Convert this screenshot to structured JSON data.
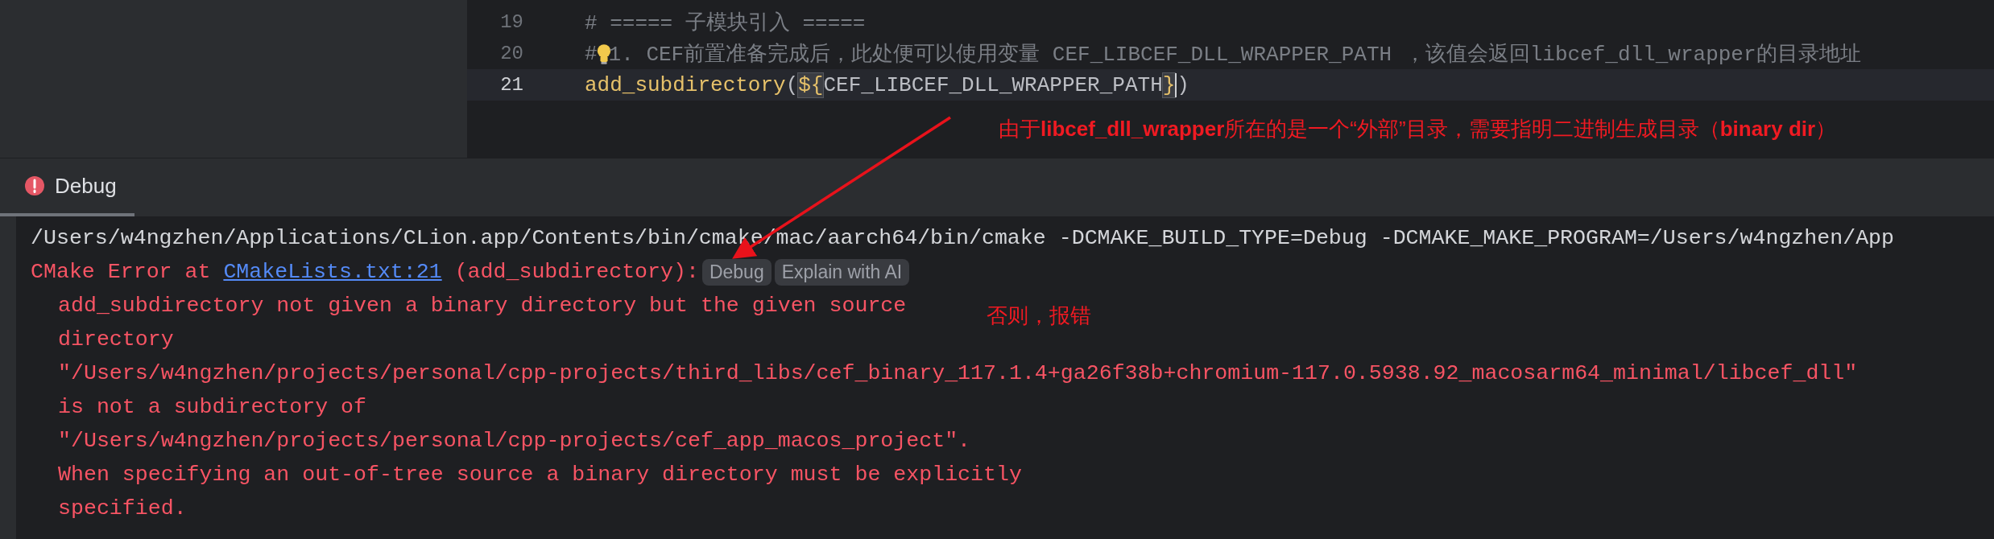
{
  "editor": {
    "lines": [
      {
        "number": "19",
        "current": false,
        "tokens": [
          {
            "kind": "comment",
            "text": "# ===== 子模块引入 ====="
          }
        ]
      },
      {
        "number": "20",
        "current": false,
        "tokens": [
          {
            "kind": "comment",
            "text": "#"
          },
          {
            "kind": "bulb"
          },
          {
            "kind": "comment",
            "text": "1. CEF前置准备完成后，此处便可以使用变量 CEF_LIBCEF_DLL_WRAPPER_PATH ，该值会返回libcef_dll_wrapper的目录地址"
          }
        ]
      },
      {
        "number": "21",
        "current": true,
        "tokens": [
          {
            "kind": "function",
            "text": "add_subdirectory"
          },
          {
            "kind": "plain",
            "text": "("
          },
          {
            "kind": "brace",
            "text": "${"
          },
          {
            "kind": "plain",
            "text": "CEF_LIBCEF_DLL_WRAPPER_PATH"
          },
          {
            "kind": "brace",
            "text": "}"
          },
          {
            "kind": "caret"
          },
          {
            "kind": "plain",
            "text": ")"
          }
        ]
      }
    ]
  },
  "debug_panel": {
    "tab": {
      "label": "Debug",
      "selected": true
    },
    "console": [
      {
        "kind": "command",
        "indent": false,
        "parts": [
          {
            "kind": "text",
            "text": "/Users/w4ngzhen/Applications/CLion.app/Contents/bin/cmake/mac/aarch64/bin/cmake -DCMAKE_BUILD_TYPE=Debug -DCMAKE_MAKE_PROGRAM=/Users/w4ngzhen/App"
          }
        ]
      },
      {
        "kind": "error",
        "indent": false,
        "parts": [
          {
            "kind": "text",
            "text": "CMake Error at "
          },
          {
            "kind": "link",
            "text": "CMakeLists.txt:21"
          },
          {
            "kind": "text",
            "text": " (add_subdirectory):"
          },
          {
            "kind": "action",
            "text": "Debug"
          },
          {
            "kind": "action",
            "text": "Explain with AI"
          }
        ]
      },
      {
        "kind": "error",
        "indent": true,
        "parts": [
          {
            "kind": "text",
            "text": "add_subdirectory not given a binary directory but the given source"
          }
        ]
      },
      {
        "kind": "error",
        "indent": true,
        "parts": [
          {
            "kind": "text",
            "text": "directory"
          }
        ]
      },
      {
        "kind": "error",
        "indent": true,
        "parts": [
          {
            "kind": "text",
            "text": "\"/Users/w4ngzhen/projects/personal/cpp-projects/third_libs/cef_binary_117.1.4+ga26f38b+chromium-117.0.5938.92_macosarm64_minimal/libcef_dll\""
          }
        ]
      },
      {
        "kind": "error",
        "indent": true,
        "parts": [
          {
            "kind": "text",
            "text": "is not a subdirectory of"
          }
        ]
      },
      {
        "kind": "error",
        "indent": true,
        "parts": [
          {
            "kind": "text",
            "text": "\"/Users/w4ngzhen/projects/personal/cpp-projects/cef_app_macos_project\"."
          }
        ]
      },
      {
        "kind": "error",
        "indent": true,
        "parts": [
          {
            "kind": "text",
            "text": "When specifying an out-of-tree source a binary directory must be explicitly"
          }
        ]
      },
      {
        "kind": "error",
        "indent": true,
        "parts": [
          {
            "kind": "text",
            "text": "specified."
          }
        ]
      }
    ]
  },
  "annotations": [
    {
      "text": "由于**libcef_dll_wrapper**所在的是一个“外部”目录，需要指明二进制生成目录（**binary dir**）"
    },
    {
      "text": "否则，报错"
    }
  ]
}
